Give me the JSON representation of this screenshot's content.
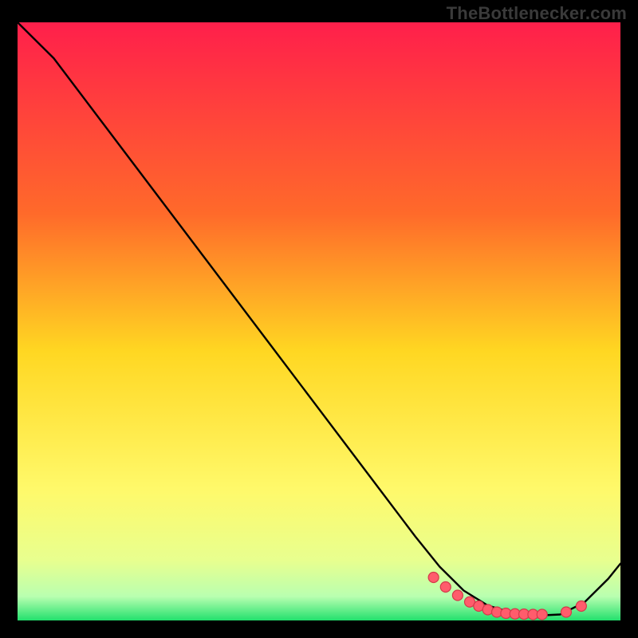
{
  "watermark": "TheBottlenecker.com",
  "colors": {
    "bg": "#000000",
    "grad_top": "#ff1f4b",
    "grad_mid_upper": "#ff6a2a",
    "grad_mid": "#ffd722",
    "grad_mid_lower": "#fff96a",
    "grad_low1": "#e8ff8f",
    "grad_low2": "#b9ffb0",
    "grad_bottom": "#23e06d",
    "curve": "#000000",
    "marker_fill": "#ff5c6c",
    "marker_stroke": "#d43a4a"
  },
  "chart_data": {
    "type": "line",
    "title": "",
    "xlabel": "",
    "ylabel": "",
    "xlim": [
      0,
      100
    ],
    "ylim": [
      0,
      100
    ],
    "series": [
      {
        "name": "curve",
        "x": [
          0,
          6,
          12,
          18,
          24,
          30,
          36,
          42,
          48,
          54,
          60,
          66,
          70,
          74,
          78,
          82,
          86,
          90,
          94,
          98,
          100
        ],
        "y": [
          100,
          94,
          86,
          78,
          70,
          62,
          54,
          46,
          38,
          30,
          22,
          14,
          9,
          5,
          2.5,
          1.3,
          0.8,
          1.0,
          3.0,
          7.0,
          9.5
        ]
      }
    ],
    "markers": {
      "name": "points",
      "x": [
        69,
        71,
        73,
        75,
        76.5,
        78,
        79.5,
        81,
        82.5,
        84,
        85.5,
        87,
        91,
        93.5
      ],
      "y": [
        7.2,
        5.6,
        4.2,
        3.1,
        2.4,
        1.8,
        1.4,
        1.2,
        1.1,
        1.05,
        1.0,
        1.0,
        1.4,
        2.4
      ]
    }
  }
}
